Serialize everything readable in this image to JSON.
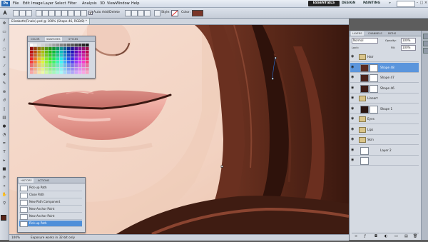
{
  "app": {
    "logo": "Ps"
  },
  "menu": [
    "File",
    "Edit",
    "Image",
    "Layer",
    "Select",
    "Filter",
    "Analysis",
    "3D",
    "View",
    "Window",
    "Help"
  ],
  "workspaces": {
    "active": "ESSENTIALS",
    "design": "DESIGN",
    "painting": "PAINTING",
    "more": "»"
  },
  "window_controls": {
    "minimize": "–",
    "restore": "□",
    "close": "×"
  },
  "options": {
    "auto_add_delete": "Auto Add/Delete",
    "style_label": "Style:",
    "color_label": "Color:",
    "color_value": "#7a3628"
  },
  "document": {
    "tab_title": "Elizabeth(Finale).psd @ 100% (Shape 46, RGB/8) *"
  },
  "status": {
    "zoom": "100%",
    "info": "Exposure works in 32-bit only"
  },
  "swatches_panel": {
    "tabs": [
      "COLOR",
      "SWATCHES",
      "STYLES"
    ],
    "active_tab": "SWATCHES"
  },
  "history_panel": {
    "tabs": [
      "HISTORY",
      "ACTIONS"
    ],
    "items": [
      {
        "label": "Pick-up Path",
        "selected": false
      },
      {
        "label": "Close Path",
        "selected": false
      },
      {
        "label": "New Path Component",
        "selected": false
      },
      {
        "label": "New Anchor Point",
        "selected": false
      },
      {
        "label": "New Anchor Point",
        "selected": false
      },
      {
        "label": "Pick-up Path",
        "selected": true
      }
    ]
  },
  "layers_panel": {
    "tabs": [
      "LAYERS",
      "CHANNELS",
      "PATHS"
    ],
    "blend_mode": "Normal",
    "opacity_label": "Opacity:",
    "opacity": "100%",
    "lock_label": "Lock:",
    "fill_label": "Fill:",
    "fill": "100%",
    "layers": [
      {
        "name": "Hair",
        "group": true,
        "color": "#d9c48a",
        "selected": false
      },
      {
        "name": "Shape 48",
        "group": false,
        "color": "#5a2a20",
        "selected": true
      },
      {
        "name": "Shape 47",
        "group": false,
        "color": "#4a221a",
        "selected": false
      },
      {
        "name": "Shape 46",
        "group": false,
        "color": "#3e1c16",
        "selected": false
      },
      {
        "name": "Lineart",
        "group": true,
        "color": "#d9c48a",
        "selected": false
      },
      {
        "name": "Shape 1",
        "group": false,
        "color": "#2a1410",
        "selected": false
      },
      {
        "name": "Eyes",
        "group": true,
        "color": "#d9c48a",
        "selected": false
      },
      {
        "name": "Lips",
        "group": true,
        "color": "#d9c48a",
        "selected": false
      },
      {
        "name": "Skin",
        "group": true,
        "color": "#d9c48a",
        "selected": false
      },
      {
        "name": "Layer 2",
        "group": false,
        "color": "#ffffff",
        "selected": false
      },
      {
        "name": "",
        "group": false,
        "color": "#ffffff",
        "selected": false
      }
    ]
  },
  "colors": {
    "skin": "#f3d5c6",
    "hair_dark": "#3b1a12",
    "hair_mid": "#6e3222",
    "lip": "#e39a92",
    "selection": "#4e8fd9"
  }
}
